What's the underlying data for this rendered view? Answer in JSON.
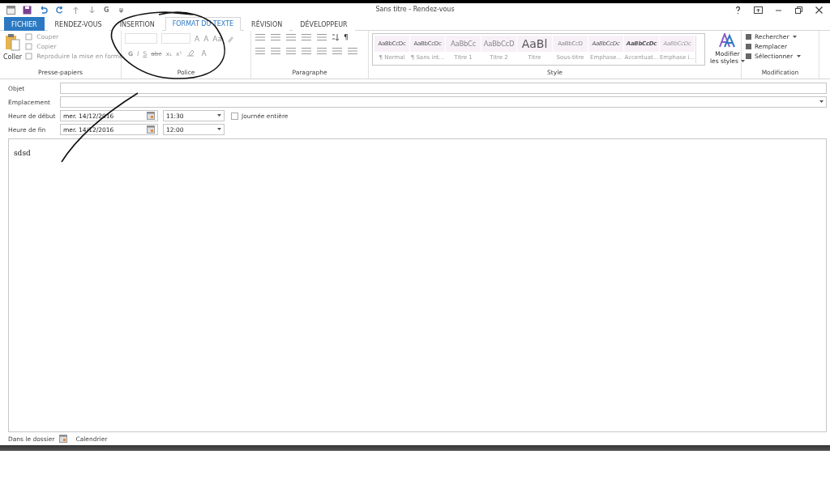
{
  "window": {
    "title": "Sans titre - Rendez-vous",
    "quick_access": [
      "G"
    ]
  },
  "tabs": [
    {
      "label": "FICHIER",
      "kind": "file",
      "selected": false
    },
    {
      "label": "RENDEZ-VOUS",
      "kind": "tab",
      "selected": false
    },
    {
      "label": "INSERTION",
      "kind": "tab",
      "selected": false
    },
    {
      "label": "FORMAT DU TEXTE",
      "kind": "tab",
      "selected": true
    },
    {
      "label": "RÉVISION",
      "kind": "tab",
      "selected": false
    },
    {
      "label": "DÉVELOPPEUR",
      "kind": "tab",
      "selected": false
    }
  ],
  "ribbon": {
    "clipboard": {
      "label": "Presse-papiers",
      "paste": "Coller",
      "items": [
        "Couper",
        "Copier",
        "Reproduire la mise en forme"
      ]
    },
    "font": {
      "label": "Police",
      "size_buttons": [
        "A",
        "A",
        "Aa"
      ],
      "format_buttons": [
        "G",
        "I",
        "S",
        "abc",
        "x₁",
        "x¹"
      ],
      "color_button": "A"
    },
    "paragraph": {
      "label": "Paragraphe",
      "pilcrow": "¶"
    },
    "style": {
      "label": "Style",
      "styles": [
        {
          "preview": "AaBbCcDc",
          "name": "¶ Normal",
          "kind": "normal"
        },
        {
          "preview": "AaBbCcDc",
          "name": "¶ Sans int...",
          "kind": "normal"
        },
        {
          "preview": "AaBbCc",
          "name": "Titre 1",
          "kind": "heading"
        },
        {
          "preview": "AaBbCcD",
          "name": "Titre 2",
          "kind": "heading"
        },
        {
          "preview": "AaBl",
          "name": "Titre",
          "kind": "title"
        },
        {
          "preview": "AaBbCcD",
          "name": "Sous-titre",
          "kind": "subtitle"
        },
        {
          "preview": "AaBbCcDc",
          "name": "Emphase...",
          "kind": "emphasis"
        },
        {
          "preview": "AaBbCcDc",
          "name": "Accentuat...",
          "kind": "strong"
        },
        {
          "preview": "AaBbCcDc",
          "name": "Emphase i...",
          "kind": "faint"
        }
      ],
      "modify": "Modifier",
      "modify_line2": "les styles"
    },
    "editing": {
      "label": "Modification",
      "items": [
        {
          "label": "Rechercher",
          "dropdown": true
        },
        {
          "label": "Remplacer",
          "dropdown": false
        },
        {
          "label": "Sélectionner",
          "dropdown": true
        }
      ]
    }
  },
  "form": {
    "subject": {
      "label": "Objet"
    },
    "location": {
      "label": "Emplacement"
    },
    "start": {
      "label": "Heure de début",
      "date": "mer. 14/12/2016",
      "time": "11:30"
    },
    "end": {
      "label": "Heure de fin",
      "date": "mer. 14/12/2016",
      "time": "12:00"
    },
    "all_day": {
      "label": "Journée entière",
      "checked": false
    }
  },
  "body": {
    "text": "sdsd"
  },
  "footer": {
    "label": "Dans le dossier",
    "folder": "Calendrier"
  }
}
